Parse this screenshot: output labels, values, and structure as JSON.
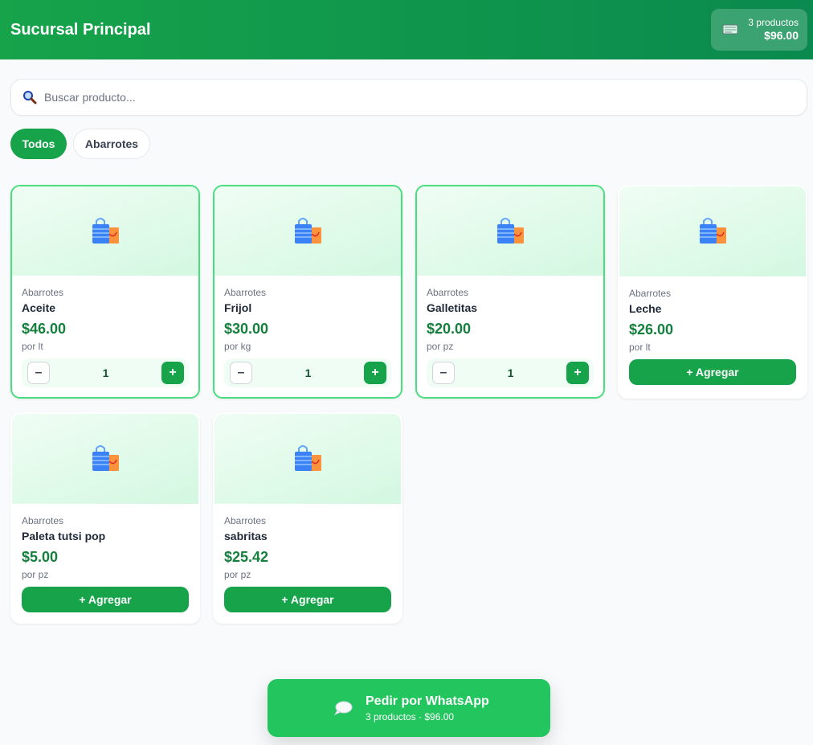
{
  "header": {
    "title": "Sucursal Principal",
    "cart": {
      "icon": "cart-icon",
      "count_label": "3 productos",
      "total": "$96.00"
    }
  },
  "search": {
    "placeholder": "Buscar producto...",
    "value": ""
  },
  "filters": [
    {
      "label": "Todos",
      "active": true
    },
    {
      "label": "Abarrotes",
      "active": false
    }
  ],
  "products": [
    {
      "category": "Abarrotes",
      "name": "Aceite",
      "price": "$46.00",
      "unit": "por lt",
      "in_cart": true,
      "qty": "1",
      "minus": "–",
      "plus": "+"
    },
    {
      "category": "Abarrotes",
      "name": "Frijol",
      "price": "$30.00",
      "unit": "por kg",
      "in_cart": true,
      "qty": "1",
      "minus": "–",
      "plus": "+"
    },
    {
      "category": "Abarrotes",
      "name": "Galletitas",
      "price": "$20.00",
      "unit": "por pz",
      "in_cart": true,
      "qty": "1",
      "minus": "–",
      "plus": "+"
    },
    {
      "category": "Abarrotes",
      "name": "Leche",
      "price": "$26.00",
      "unit": "por lt",
      "in_cart": false,
      "add_label": "+ Agregar"
    },
    {
      "category": "Abarrotes",
      "name": "Paleta tutsi pop",
      "price": "$5.00",
      "unit": "por pz",
      "in_cart": false,
      "add_label": "+ Agregar"
    },
    {
      "category": "Abarrotes",
      "name": "sabritas",
      "price": "$25.42",
      "unit": "por pz",
      "in_cart": false,
      "add_label": "+ Agregar"
    }
  ],
  "whatsapp": {
    "icon": "speech-bubble-icon",
    "title": "Pedir por WhatsApp",
    "subtitle": "3 productos · $96.00"
  },
  "colors": {
    "brand": "#16a34a",
    "header_end": "#0a8a4e",
    "price": "#15803d",
    "whatsapp": "#22c55e",
    "in_cart_border": "#4ade80"
  }
}
